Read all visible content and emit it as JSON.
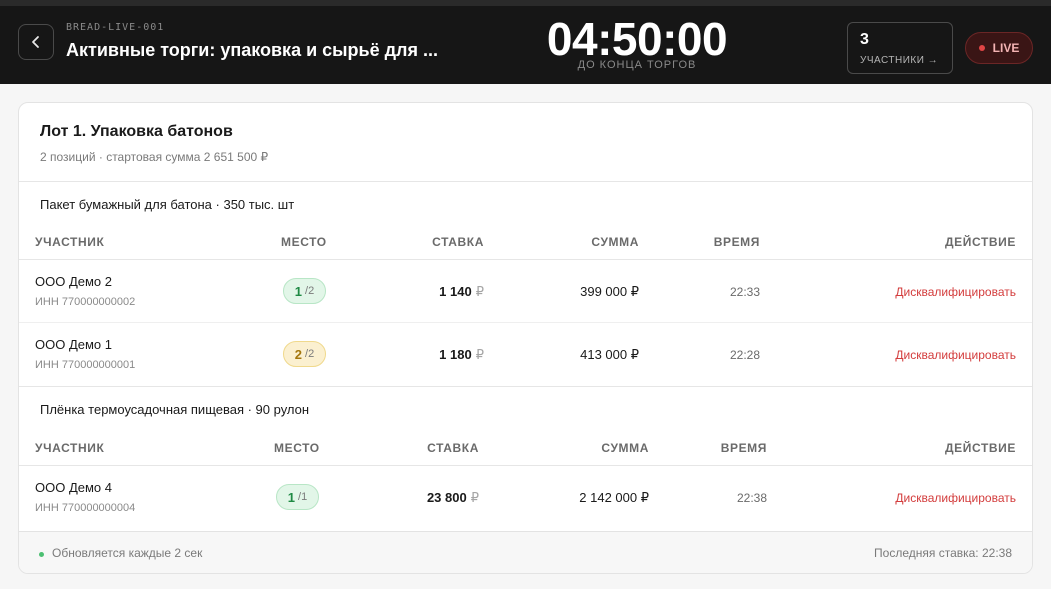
{
  "header": {
    "back_icon": "chevron-left-icon",
    "code": "BREAD-LIVE-001",
    "title": "Активные торги: упаковка и сырьё для ...",
    "timer": "04:50:00",
    "timer_label": "ДО КОНЦА ТОРГОВ",
    "participants_count": "3",
    "participants_label": "УЧАСТНИКИ →",
    "live_label": "LIVE",
    "live_color": "#e04545"
  },
  "lot": {
    "title": "Лот 1. Упаковка батонов",
    "subtitle": "2 позиций · стартовая сумма 2 651 500 ₽"
  },
  "columns": {
    "participant": "УЧАСТНИК",
    "place": "МЕСТО",
    "bid": "СТАВКА",
    "sum": "СУММА",
    "time": "ВРЕМЯ",
    "action": "ДЕЙСТВИЕ"
  },
  "items": [
    {
      "name": "Пакет бумажный для батона · 350 тыс. шт",
      "rows": [
        {
          "company": "ООО Демо 2",
          "inn": "ИНН 770000000002",
          "place": "1",
          "of": "/2",
          "place_color": "#1f8a44",
          "bid": "1 140",
          "currency": "₽",
          "sum": "399 000 ₽",
          "time": "22:33",
          "action": "Дисквалифицировать"
        },
        {
          "company": "ООО Демо 1",
          "inn": "ИНН 770000000001",
          "place": "2",
          "of": "/2",
          "place_color": "#a4770e",
          "bid": "1 180",
          "currency": "₽",
          "sum": "413 000 ₽",
          "time": "22:28",
          "action": "Дисквалифицировать"
        }
      ]
    },
    {
      "name": "Плёнка термоусадочная пищевая · 90 рулон",
      "rows": [
        {
          "company": "ООО Демо 4",
          "inn": "ИНН 770000000004",
          "place": "1",
          "of": "/1",
          "place_color": "#1f8a44",
          "bid": "23 800",
          "currency": "₽",
          "sum": "2 142 000 ₽",
          "time": "22:38",
          "action": "Дисквалифицировать"
        }
      ]
    }
  ],
  "footer": {
    "status": "Обновляется каждые 2 сек",
    "status_color": "#4cbf72",
    "last_bid": "Последняя ставка: 22:38"
  }
}
